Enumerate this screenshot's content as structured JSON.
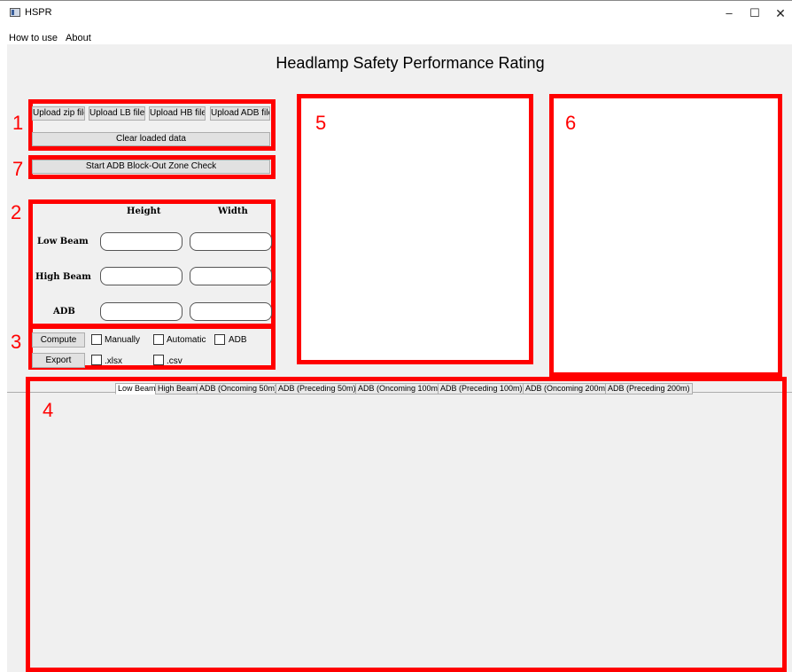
{
  "window": {
    "title": "HSPR",
    "min_symbol": "–",
    "max_symbol": "☐",
    "close_symbol": "✕"
  },
  "menu": {
    "how_to_use": "How to use",
    "about": "About"
  },
  "page_title": "Headlamp Safety Performance Rating",
  "annotations": {
    "box1": "1",
    "box2": "2",
    "box3": "3",
    "box4": "4",
    "box5": "5",
    "box6": "6",
    "box7": "7"
  },
  "upload": {
    "zip": "Upload zip file",
    "lb": "Upload LB files",
    "hb": "Upload HB files",
    "adb": "Upload ADB files",
    "clear": "Clear loaded data"
  },
  "adb_check_button": "Start ADB Block-Out Zone Check",
  "dimensions": {
    "height_header": "Height",
    "width_header": "Width",
    "rows": [
      {
        "label": "Low Beam",
        "height": "",
        "width": ""
      },
      {
        "label": "High Beam",
        "height": "",
        "width": ""
      },
      {
        "label": "ADB",
        "height": "",
        "width": ""
      }
    ]
  },
  "compute": {
    "compute_button": "Compute",
    "export_button": "Export",
    "manually": "Manually",
    "automatic": "Automatic",
    "adb": "ADB",
    "xlsx": ".xlsx",
    "csv": ".csv"
  },
  "tabs": [
    "Low Beam",
    "High Beam",
    "ADB (Oncoming 50m)",
    "ADB (Preceding 50m)",
    "ADB (Oncoming 100m)",
    "ADB (Preceding 100m)",
    "ADB (Oncoming 200m)",
    "ADB (Preceding 200m)"
  ],
  "colors": {
    "annotation": "#ff0000",
    "background": "#f0f0f0",
    "button": "#e1e1e1"
  }
}
